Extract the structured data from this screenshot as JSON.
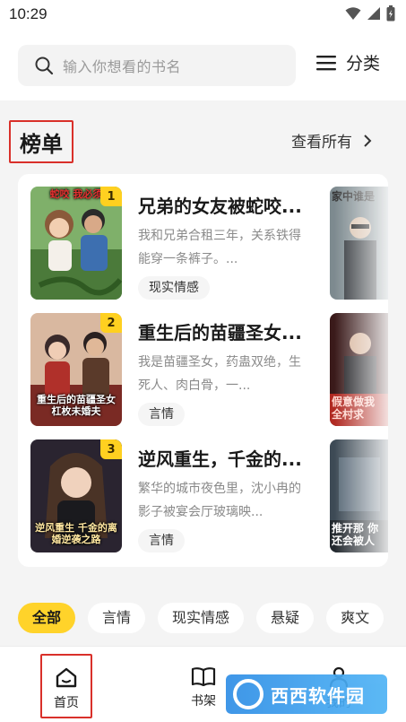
{
  "status_bar": {
    "time": "10:29",
    "icons": [
      "wifi-icon",
      "signal-icon",
      "battery-icon"
    ]
  },
  "search": {
    "placeholder": "输入你想看的书名",
    "icon": "search-icon"
  },
  "category_button": {
    "label": "分类",
    "icon": "menu-icon"
  },
  "ranking": {
    "title": "榜单",
    "view_all_label": "查看所有",
    "books": [
      {
        "rank": "1",
        "title": "兄弟的女友被蛇咬...",
        "description": "我和兄弟合租三年，关系铁得能穿一条裤子。...",
        "tag": "现实情感",
        "cover_caption": "蛇咬 我必须",
        "side_cover_caption": "家中谁是"
      },
      {
        "rank": "2",
        "title": "重生后的苗疆圣女...",
        "description": "我是苗疆圣女，药蛊双绝，生死人、肉白骨，一...",
        "tag": "言情",
        "cover_caption": "重生后的苗疆圣女 杠枚未婚夫",
        "side_cover_caption": "假意做我 全村求"
      },
      {
        "rank": "3",
        "title": "逆风重生，千金的...",
        "description": "繁华的城市夜色里，沈小冉的影子被宴会厅玻璃映...",
        "tag": "言情",
        "cover_caption": "逆风重生 千金的离婚逆袭之路",
        "side_cover_caption": "推开那 你还会被人"
      }
    ]
  },
  "chips": [
    "全部",
    "言情",
    "现实情感",
    "悬疑",
    "爽文"
  ],
  "active_chip": "全部",
  "tabbar": {
    "home": "首页",
    "shelf": "书架",
    "me": "我的"
  },
  "watermark": {
    "text": "西西软件园"
  },
  "colors": {
    "accent_yellow": "#ffd32a",
    "highlight_red": "#d9302a",
    "watermark_blue": "#2f8ee6"
  }
}
